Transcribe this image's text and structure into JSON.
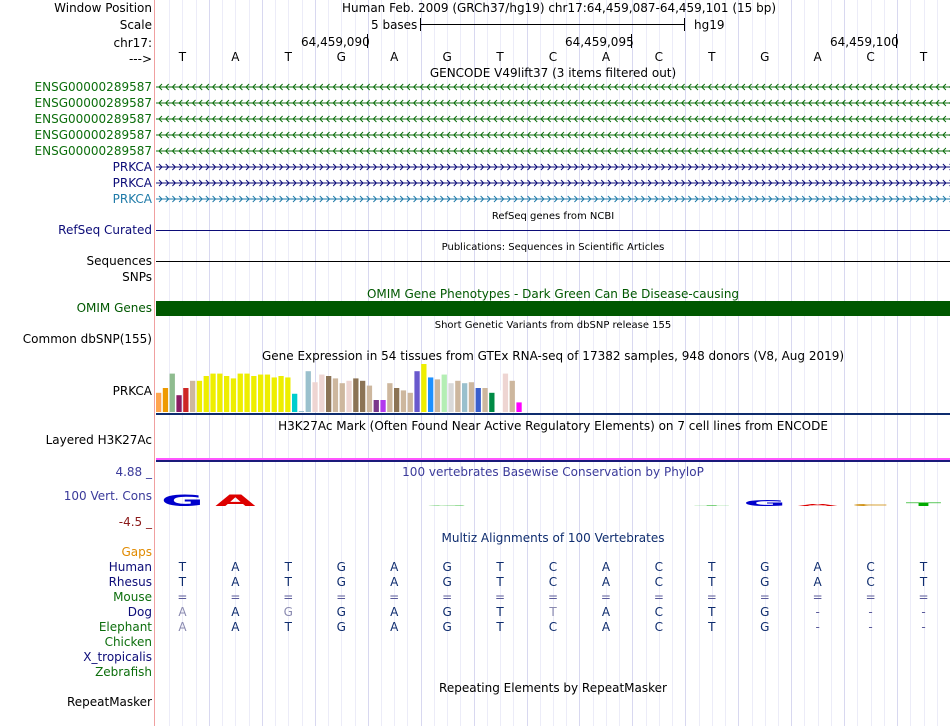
{
  "header": {
    "window_position_label": "Window Position",
    "window_position_value": "Human Feb. 2009 (GRCh37/hg19)   chr17:64,459,087-64,459,101 (15 bp)",
    "scale_label": "Scale",
    "scale_bases": "5 bases",
    "scale_assembly": "hg19",
    "chrom_label": "chr17:",
    "positions": [
      "64,459,090",
      "64,459,095",
      "64,459,100"
    ],
    "strand_label": "--->",
    "bases": [
      "T",
      "A",
      "T",
      "G",
      "A",
      "G",
      "T",
      "C",
      "A",
      "C",
      "T",
      "G",
      "A",
      "C",
      "T"
    ]
  },
  "gencode": {
    "title": "GENCODE V49lift37 (3 items filtered out)",
    "tracks": [
      {
        "name": "ENSG00000289587",
        "direction": "reverse",
        "color": "#0c6e0c"
      },
      {
        "name": "ENSG00000289587",
        "direction": "reverse",
        "color": "#0c6e0c"
      },
      {
        "name": "ENSG00000289587",
        "direction": "reverse",
        "color": "#0c6e0c"
      },
      {
        "name": "ENSG00000289587",
        "direction": "reverse",
        "color": "#0c6e0c"
      },
      {
        "name": "ENSG00000289587",
        "direction": "reverse",
        "color": "#0c6e0c"
      },
      {
        "name": "PRKCA",
        "direction": "forward",
        "color": "#0c0c78"
      },
      {
        "name": "PRKCA",
        "direction": "forward",
        "color": "#0c0c78"
      },
      {
        "name": "PRKCA",
        "direction": "forward",
        "color": "#1e7aa8"
      }
    ]
  },
  "refseq": {
    "title": "RefSeq genes from NCBI",
    "label": "RefSeq Curated",
    "color": "#0c0c78"
  },
  "publications": {
    "title": "Publications: Sequences in Scientific Articles",
    "label": "Sequences",
    "snps_label": "SNPs"
  },
  "omim": {
    "title": "OMIM Gene Phenotypes - Dark Green Can Be Disease-causing",
    "label": "OMIM Genes",
    "color": "#005800"
  },
  "dbsnp": {
    "title": "Short Genetic Variants from dbSNP release 155",
    "label": "Common dbSNP(155)"
  },
  "gtex": {
    "title": "Gene Expression in 54 tissues from GTEx RNA-seq of 17382 samples, 948 donors (V8, Aug 2019)",
    "label": "PRKCA",
    "chart_data": {
      "type": "bar",
      "values": [
        0.4,
        0.5,
        0.8,
        0.35,
        0.5,
        0.65,
        0.65,
        0.75,
        0.8,
        0.8,
        0.75,
        0.7,
        0.8,
        0.8,
        0.75,
        0.78,
        0.78,
        0.72,
        0.75,
        0.72,
        0.38,
        0.02,
        0.85,
        0.62,
        0.78,
        0.75,
        0.7,
        0.6,
        0.65,
        0.7,
        0.65,
        0.55,
        0.25,
        0.25,
        0.6,
        0.5,
        0.45,
        0.4,
        0.85,
        1.0,
        0.72,
        0.68,
        0.78,
        0.6,
        0.65,
        0.6,
        0.62,
        0.5,
        0.5,
        0.4,
        0.45,
        0.8,
        0.65,
        0.2
      ],
      "colors": [
        "#ffa54f",
        "#ee9a00",
        "#8fbc8f",
        "#8b1c62",
        "#cd2626",
        "#cdb79e",
        "#eeee00",
        "#eeee00",
        "#eeee00",
        "#eeee00",
        "#eeee00",
        "#eeee00",
        "#eeee00",
        "#eeee00",
        "#eeee00",
        "#eeee00",
        "#eeee00",
        "#eeee00",
        "#eeee00",
        "#eeee00",
        "#00cdcd",
        "#9ac0cd",
        "#9ac0cd",
        "#eed5d2",
        "#eed5d2",
        "#8b7355",
        "#cdb79e",
        "#cdb79e",
        "#eed5d2",
        "#8b7355",
        "#8b7355",
        "#cdb79e",
        "#7a378b",
        "#b23aee",
        "#cdb79e",
        "#8b7355",
        "#cdb79e",
        "#cdb79e",
        "#6959cd",
        "#eeee00",
        "#1e90ff",
        "#cdb79e",
        "#b4eeb4",
        "#d9d9d9",
        "#cdb79e",
        "#9ac0cd",
        "#cdb79e",
        "#3a5fcd",
        "#cdb79e",
        "#008b45",
        "#ffffff",
        "#eed5d2",
        "#cdb79e",
        "#ff00ff"
      ]
    }
  },
  "h3k27ac": {
    "title": "H3K27Ac Mark (Often Found Near Active Regulatory Elements) on 7 cell lines from ENCODE",
    "label": "Layered H3K27Ac"
  },
  "phylop": {
    "title": "100 vertebrates Basewise Conservation by PhyloP",
    "label": "100 Vert. Cons",
    "max": "4.88 _",
    "min": "-4.5 _",
    "logo": [
      {
        "letter": "G",
        "color": "#0000cc",
        "h": 0.9
      },
      {
        "letter": "A",
        "color": "#dd0000",
        "h": 0.9
      },
      {
        "letter": "",
        "color": "#000",
        "h": 0
      },
      {
        "letter": "",
        "color": "#000",
        "h": 0
      },
      {
        "letter": "",
        "color": "#000",
        "h": 0
      },
      {
        "letter": "G",
        "color": "#00aa00",
        "h": 0.05
      },
      {
        "letter": "",
        "color": "#000",
        "h": 0
      },
      {
        "letter": "",
        "color": "#000",
        "h": 0
      },
      {
        "letter": "",
        "color": "#000",
        "h": 0
      },
      {
        "letter": "",
        "color": "#000",
        "h": 0
      },
      {
        "letter": "T",
        "color": "#00aa00",
        "h": 0.05
      },
      {
        "letter": "G",
        "color": "#0000cc",
        "h": 0.45
      },
      {
        "letter": "A",
        "color": "#dd0000",
        "h": 0.15
      },
      {
        "letter": "C",
        "color": "#cc8800",
        "h": 0.12
      },
      {
        "letter": "T",
        "color": "#00aa00",
        "h": 0.25
      }
    ]
  },
  "multiz": {
    "title": "Multiz Alignments of 100 Vertebrates",
    "gaps_label": "Gaps",
    "species": [
      {
        "name": "Human",
        "color": "#0c0c78",
        "seq": [
          "T",
          "A",
          "T",
          "G",
          "A",
          "G",
          "T",
          "C",
          "A",
          "C",
          "T",
          "G",
          "A",
          "C",
          "T"
        ]
      },
      {
        "name": "Rhesus",
        "color": "#0c0c78",
        "seq": [
          "T",
          "A",
          "T",
          "G",
          "A",
          "G",
          "T",
          "C",
          "A",
          "C",
          "T",
          "G",
          "A",
          "C",
          "T"
        ]
      },
      {
        "name": "Mouse",
        "color": "#0c6e0c",
        "seq": [
          "=",
          "=",
          "=",
          "=",
          "=",
          "=",
          "=",
          "=",
          "=",
          "=",
          "=",
          "=",
          "=",
          "=",
          "="
        ]
      },
      {
        "name": "Dog",
        "color": "#0c0c78",
        "seq": [
          "A",
          "A",
          "G",
          "G",
          "A",
          "G",
          "T",
          "T",
          "A",
          "C",
          "T",
          "G",
          "-",
          "-",
          "-"
        ]
      },
      {
        "name": "Elephant",
        "color": "#0c6e0c",
        "seq": [
          "A",
          "A",
          "T",
          "G",
          "A",
          "G",
          "T",
          "C",
          "A",
          "C",
          "T",
          "G",
          "-",
          "-",
          "-"
        ]
      },
      {
        "name": "Chicken",
        "color": "#0c6e0c",
        "seq": []
      },
      {
        "name": "X_tropicalis",
        "color": "#0c0c78",
        "seq": []
      },
      {
        "name": "Zebrafish",
        "color": "#0c6e0c",
        "seq": []
      }
    ]
  },
  "repeatmasker": {
    "title": "Repeating Elements by RepeatMasker",
    "label": "RepeatMasker"
  }
}
